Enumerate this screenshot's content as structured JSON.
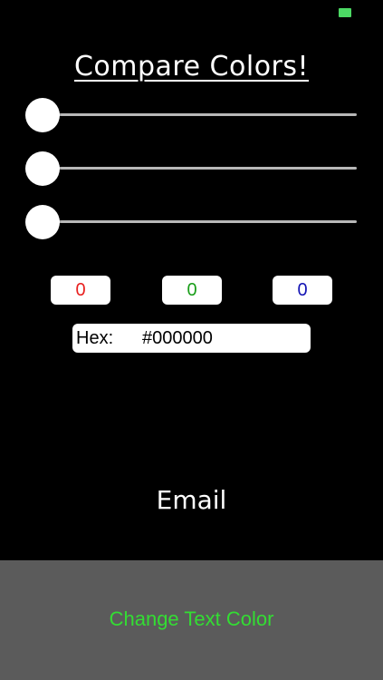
{
  "status_bar": {
    "battery_color": "#4cd964"
  },
  "title": "Compare Colors!",
  "sliders": [
    {
      "name": "red",
      "value": 0
    },
    {
      "name": "green",
      "value": 0
    },
    {
      "name": "blue",
      "value": 0
    }
  ],
  "values": {
    "red": "0",
    "green": "0",
    "blue": "0",
    "red_color": "#e8201f",
    "green_color": "#1a9e1a",
    "blue_color": "#1414b4"
  },
  "hex": {
    "label": "Hex:",
    "value": "#000000"
  },
  "email_label": "Email",
  "change_text_color_label": "Change Text Color",
  "colors": {
    "background": "#000000",
    "bottom_bar": "#5b5b5b",
    "change_text_color": "#33dd33"
  }
}
